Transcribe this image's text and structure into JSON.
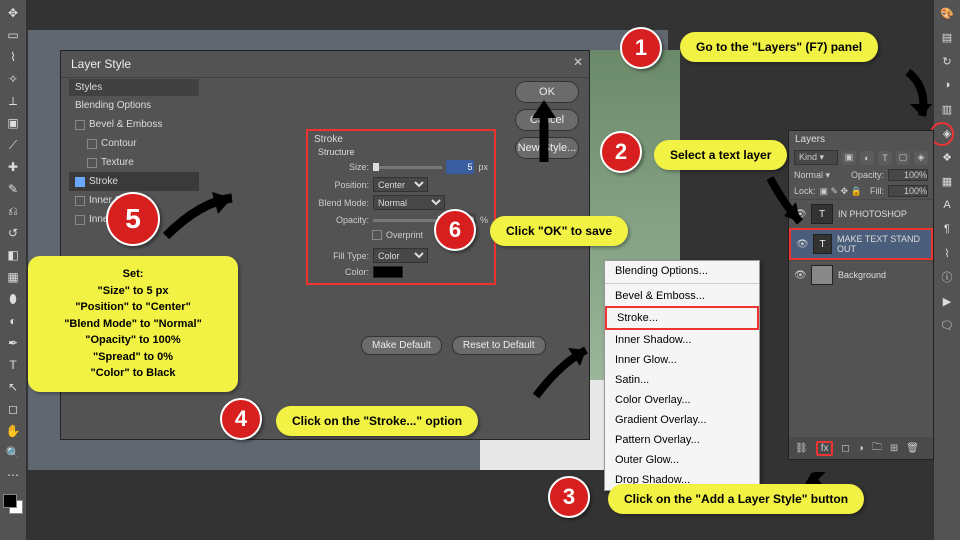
{
  "dialog": {
    "title": "Layer Style",
    "styles_header": "Styles",
    "blending": "Blending Options",
    "opts": {
      "bevel": "Bevel & Emboss",
      "contour": "Contour",
      "texture": "Texture",
      "stroke": "Stroke",
      "inner_shadow": "Inner Shadow",
      "inner_glow": "Inner Glow"
    },
    "stroke": {
      "header": "Stroke",
      "structure": "Structure",
      "size_l": "Size:",
      "size_v": "5",
      "px": "px",
      "position_l": "Position:",
      "position_v": "Center",
      "blend_l": "Blend Mode:",
      "blend_v": "Normal",
      "opacity_l": "Opacity:",
      "opacity_v": "100",
      "pct": "%",
      "overprint": "Overprint",
      "filltype_l": "Fill Type:",
      "filltype_v": "Color",
      "color_l": "Color:"
    },
    "buttons": {
      "ok": "OK",
      "cancel": "Cancel",
      "newstyle": "New Style...",
      "make_default": "Make Default",
      "reset_default": "Reset to Default"
    }
  },
  "layers": {
    "tab": "Layers",
    "kind": "Kind",
    "blend": "Normal",
    "opacity_l": "Opacity:",
    "opacity_v": "100%",
    "lock_l": "Lock:",
    "fill_l": "Fill:",
    "fill_v": "100%",
    "items": {
      "top": "IN PHOTOSHOP",
      "text": "MAKE TEXT STAND OUT",
      "bg": "Background"
    },
    "fx": "fx"
  },
  "ctx": {
    "blending": "Blending Options...",
    "bevel": "Bevel & Emboss...",
    "stroke": "Stroke...",
    "inner_shadow": "Inner Shadow...",
    "inner_glow": "Inner Glow...",
    "satin": "Satin...",
    "color_overlay": "Color Overlay...",
    "gradient_overlay": "Gradient Overlay...",
    "pattern_overlay": "Pattern Overlay...",
    "outer_glow": "Outer Glow...",
    "drop_shadow": "Drop Shadow..."
  },
  "callouts": {
    "c1": "Go to the \"Layers\" (F7) panel",
    "c2": "Select a text layer",
    "c3": "Click on the \"Add a Layer Style\" button",
    "c4": "Click on the \"Stroke...\" option",
    "c5_title": "Set:",
    "c5_l1": "\"Size\" to 5 px",
    "c5_l2": "\"Position\" to \"Center\"",
    "c5_l3": "\"Blend Mode\" to \"Normal\"",
    "c5_l4": "\"Opacity\" to 100%",
    "c5_l5": "\"Spread\" to 0%",
    "c5_l6": "\"Color\" to Black",
    "c6": "Click \"OK\" to save"
  },
  "badges": {
    "b1": "1",
    "b2": "2",
    "b3": "3",
    "b4": "4",
    "b5": "5",
    "b6": "6"
  }
}
